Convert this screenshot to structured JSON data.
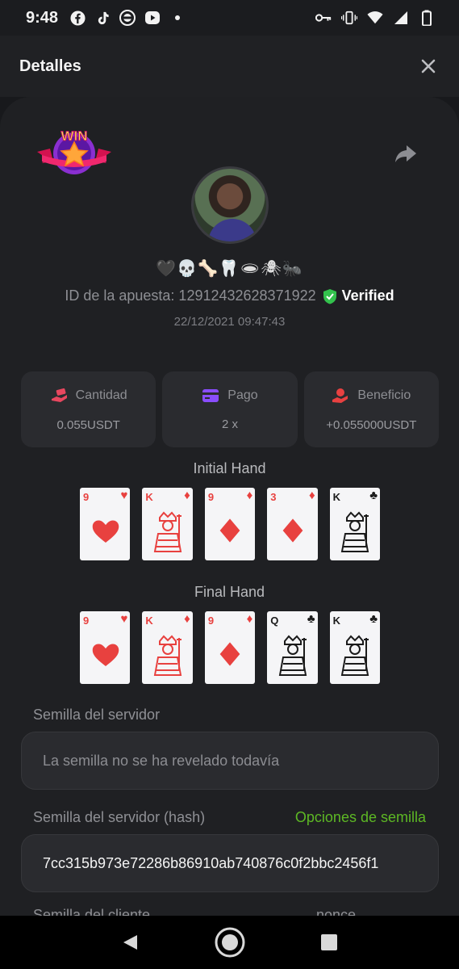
{
  "status_bar": {
    "time": "9:48",
    "left_icons": [
      "facebook-icon",
      "tiktok-icon",
      "wsop-icon",
      "youtube-icon",
      "dot-icon"
    ],
    "right_icons": [
      "key-icon",
      "vibrate-icon",
      "wifi-icon",
      "signal-icon",
      "battery-icon"
    ]
  },
  "header": {
    "title": "Detalles"
  },
  "bet": {
    "emoji_tag": "🖤💀🦴🦷🕳🕷🐜",
    "id_label": "ID de la apuesta: 12912432628371922",
    "verified_label": "Verified",
    "datetime": "22/12/2021 09:47:43",
    "win_badge_text": "WIN"
  },
  "stats": [
    {
      "label": "Cantidad",
      "value": "0.055USDT",
      "icon": "money-hand-icon",
      "color": "#e8475f"
    },
    {
      "label": "Pago",
      "value": "2 x",
      "icon": "card-icon",
      "color": "#8a4dff"
    },
    {
      "label": "Beneficio",
      "value": "+0.055000USDT",
      "icon": "profit-hand-icon",
      "color": "#e84141"
    }
  ],
  "initial_hand": {
    "title": "Initial Hand",
    "cards": [
      {
        "rank": "9",
        "suit": "♥",
        "color": "#e8413f",
        "face": false
      },
      {
        "rank": "K",
        "suit": "♦",
        "color": "#e8413f",
        "face": true
      },
      {
        "rank": "9",
        "suit": "♦",
        "color": "#e8413f",
        "face": false
      },
      {
        "rank": "3",
        "suit": "♦",
        "color": "#e8413f",
        "face": false
      },
      {
        "rank": "K",
        "suit": "♣",
        "color": "#1b1b1b",
        "face": true
      }
    ]
  },
  "final_hand": {
    "title": "Final Hand",
    "cards": [
      {
        "rank": "9",
        "suit": "♥",
        "color": "#e8413f",
        "face": false
      },
      {
        "rank": "K",
        "suit": "♦",
        "color": "#e8413f",
        "face": true
      },
      {
        "rank": "9",
        "suit": "♦",
        "color": "#e8413f",
        "face": false
      },
      {
        "rank": "Q",
        "suit": "♣",
        "color": "#1b1b1b",
        "face": true
      },
      {
        "rank": "K",
        "suit": "♣",
        "color": "#1b1b1b",
        "face": true
      }
    ]
  },
  "server_seed": {
    "label": "Semilla del servidor",
    "value": "La semilla no se ha revelado todavía"
  },
  "server_seed_hash": {
    "label": "Semilla del servidor (hash)",
    "link": "Opciones de semilla",
    "value": "7cc315b973e72286b86910ab740876c0f2bbc2456f1"
  },
  "client_seed": {
    "label": "Semilla del cliente",
    "nonce_label": "nonce"
  },
  "accent_color": "#5db824"
}
